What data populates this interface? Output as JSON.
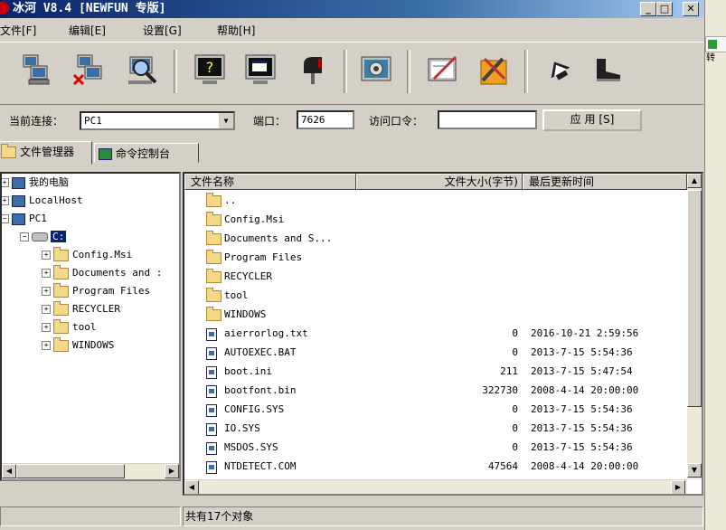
{
  "window": {
    "title": "冰河 V8.4 [NEWFUN 专版]",
    "min": "_",
    "max": "□",
    "close": "✕"
  },
  "side": {
    "button_label": "转"
  },
  "menu": [
    {
      "label": "文件[F]"
    },
    {
      "label": "编辑[E]"
    },
    {
      "label": "设置[G]"
    },
    {
      "label": "帮助[H]"
    }
  ],
  "toolbar": [
    {
      "icon": "add-host-icon"
    },
    {
      "icon": "delete-host-icon"
    },
    {
      "icon": "search-host-icon"
    },
    {
      "icon": "help-monitor-icon"
    },
    {
      "icon": "screen-capture-icon"
    },
    {
      "icon": "mailbox-icon"
    },
    {
      "icon": "gear-control-icon"
    },
    {
      "icon": "notepad-icon"
    },
    {
      "icon": "tools-icon"
    },
    {
      "icon": "arrow-up-icon"
    },
    {
      "icon": "boot-icon"
    }
  ],
  "connection": {
    "current_label": "当前连接：",
    "current_value": "PC1",
    "port_label": "端口：",
    "port_value": "7626",
    "password_label": "访问口令：",
    "password_value": "",
    "apply_label": "应 用 [S]"
  },
  "tabs": [
    {
      "label": "文件管理器"
    },
    {
      "label": "命令控制台"
    }
  ],
  "tree": {
    "items": [
      {
        "label": "我的电脑"
      },
      {
        "label": "LocalHost"
      },
      {
        "label": "PC1"
      },
      {
        "label": "C:"
      },
      {
        "label": "Config.Msi"
      },
      {
        "label": "Documents and :"
      },
      {
        "label": "Program Files"
      },
      {
        "label": "RECYCLER"
      },
      {
        "label": "tool"
      },
      {
        "label": "WINDOWS"
      }
    ]
  },
  "files": {
    "columns": [
      "文件名称",
      "文件大小(字节)",
      "最后更新时间"
    ],
    "rows": [
      {
        "name": "..",
        "size": "",
        "date": "",
        "type": "folder"
      },
      {
        "name": "Config.Msi",
        "size": "",
        "date": "",
        "type": "folder"
      },
      {
        "name": "Documents and S...",
        "size": "",
        "date": "",
        "type": "folder"
      },
      {
        "name": "Program Files",
        "size": "",
        "date": "",
        "type": "folder"
      },
      {
        "name": "RECYCLER",
        "size": "",
        "date": "",
        "type": "folder"
      },
      {
        "name": "tool",
        "size": "",
        "date": "",
        "type": "folder"
      },
      {
        "name": "WINDOWS",
        "size": "",
        "date": "",
        "type": "folder"
      },
      {
        "name": "aierrorlog.txt",
        "size": "0",
        "date": "2016-10-21 2:59:56",
        "type": "file"
      },
      {
        "name": "AUTOEXEC.BAT",
        "size": "0",
        "date": "2013-7-15 5:54:36",
        "type": "file"
      },
      {
        "name": "boot.ini",
        "size": "211",
        "date": "2013-7-15 5:47:54",
        "type": "file"
      },
      {
        "name": "bootfont.bin",
        "size": "322730",
        "date": "2008-4-14 20:00:00",
        "type": "file"
      },
      {
        "name": "CONFIG.SYS",
        "size": "0",
        "date": "2013-7-15 5:54:36",
        "type": "file"
      },
      {
        "name": "IO.SYS",
        "size": "0",
        "date": "2013-7-15 5:54:36",
        "type": "file"
      },
      {
        "name": "MSDOS.SYS",
        "size": "0",
        "date": "2013-7-15 5:54:36",
        "type": "file"
      },
      {
        "name": "NTDETECT.COM",
        "size": "47564",
        "date": "2008-4-14 20:00:00",
        "type": "file"
      }
    ]
  },
  "status": {
    "text": "共有17个对象"
  },
  "colors": {
    "titlebar": "#0a246a",
    "selection": "#0a246a",
    "face": "#d4d0c8"
  }
}
